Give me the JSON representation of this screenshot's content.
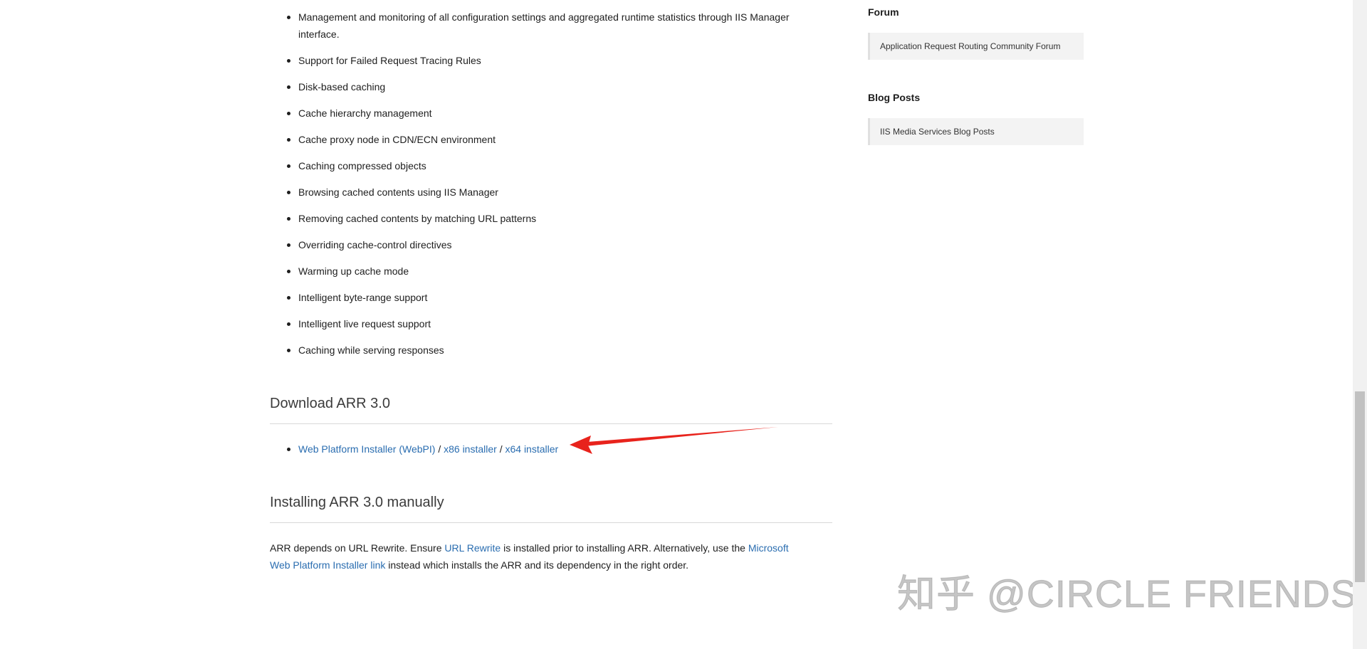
{
  "features": [
    "Management and monitoring of all configuration settings and aggregated runtime statistics through IIS Manager interface.",
    "Support for Failed Request Tracing Rules",
    "Disk-based caching",
    "Cache hierarchy management",
    "Cache proxy node in CDN/ECN environment",
    "Caching compressed objects",
    "Browsing cached contents using IIS Manager",
    "Removing cached contents by matching URL patterns",
    "Overriding cache-control directives",
    "Warming up cache mode",
    "Intelligent byte-range support",
    "Intelligent live request support",
    "Caching while serving responses"
  ],
  "download": {
    "title": "Download ARR 3.0",
    "webpi_link": "Web Platform Installer (WebPI)",
    "separator": " / ",
    "x86_link": "x86 installer",
    "x64_link": "x64 installer"
  },
  "install": {
    "title": "Installing ARR 3.0 manually",
    "text_1": "ARR depends on URL Rewrite. Ensure ",
    "link_url_rewrite": "URL Rewrite",
    "text_2": " is installed prior to installing ARR. Alternatively, use the ",
    "link_webpi": "Microsoft Web Platform Installer link",
    "text_3": " instead which installs the ARR and its dependency in the right order."
  },
  "sidebar": {
    "forum_heading": "Forum",
    "forum_link": "Application Request Routing Community Forum",
    "blog_heading": "Blog Posts",
    "blog_link": "IIS Media Services Blog Posts"
  },
  "watermark": {
    "text": "知乎 @CIRCLE FRIENDS"
  },
  "colors": {
    "link": "#2a6db0",
    "annotation_arrow": "#e8231c",
    "text": "#1e1e1e"
  }
}
